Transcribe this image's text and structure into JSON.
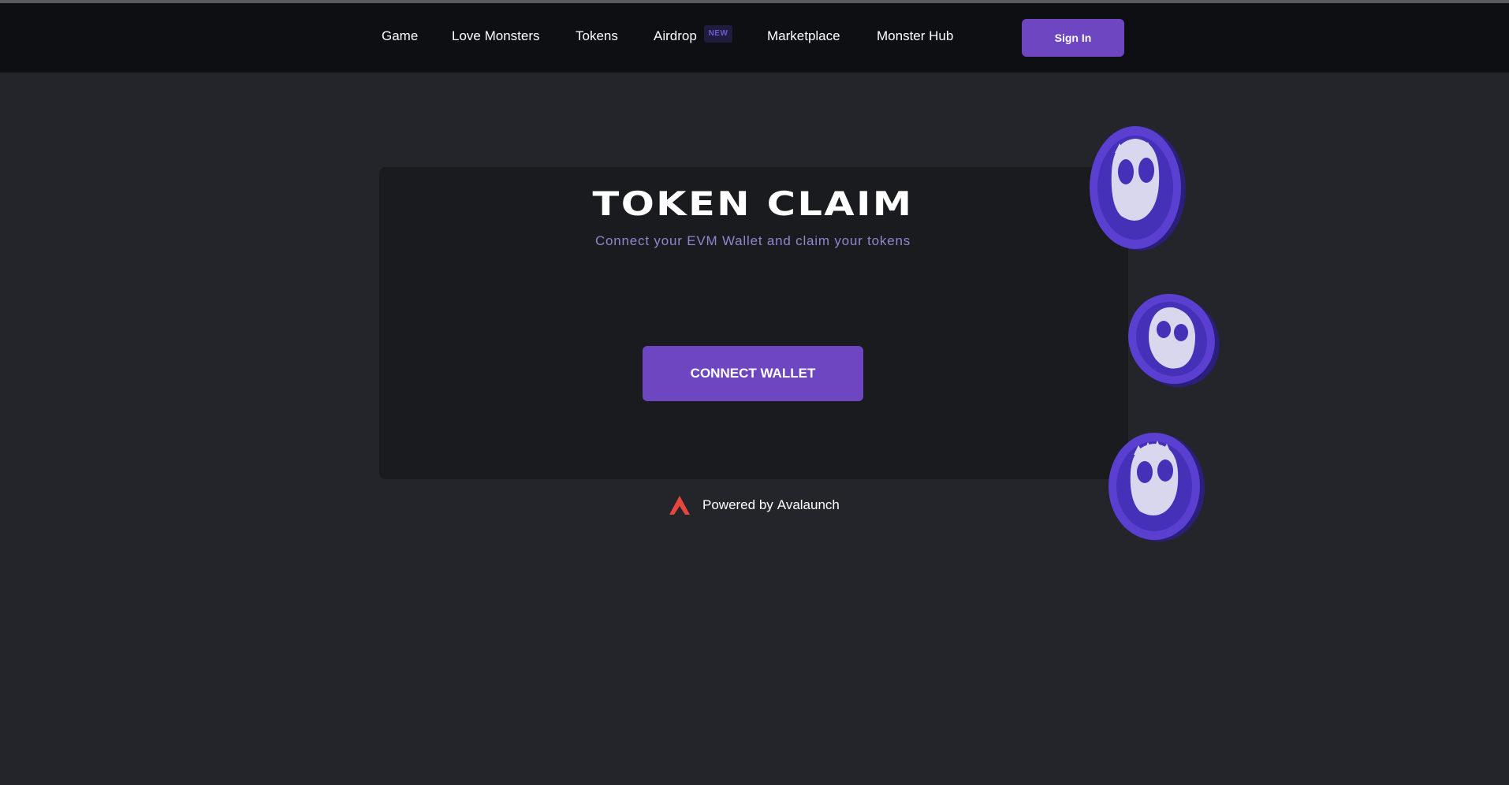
{
  "nav": {
    "items": [
      {
        "label": "Game"
      },
      {
        "label": "Love Monsters"
      },
      {
        "label": "Tokens"
      },
      {
        "label": "Airdrop",
        "badge": "NEW"
      },
      {
        "label": "Marketplace"
      },
      {
        "label": "Monster Hub"
      }
    ],
    "signin_label": "Sign In"
  },
  "claim": {
    "title": "TOKEN CLAIM",
    "subtitle": "Connect your EVM Wallet and claim your tokens",
    "connect_label": "CONNECT WALLET"
  },
  "footer": {
    "powered_prefix": "Powered by",
    "powered_brand": "Avalaunch"
  },
  "icons": {
    "brand_logo": "avalaunch-logo-icon",
    "coin": "monster-coin-icon"
  },
  "colors": {
    "accent": "#6e46c2",
    "background": "#24252a",
    "navbar": "#0d0f13",
    "card": "#1a1b1f",
    "subtitle": "#8f86cf",
    "brand_red": "#e8453c",
    "coin_purple": "#5a3fd0"
  }
}
